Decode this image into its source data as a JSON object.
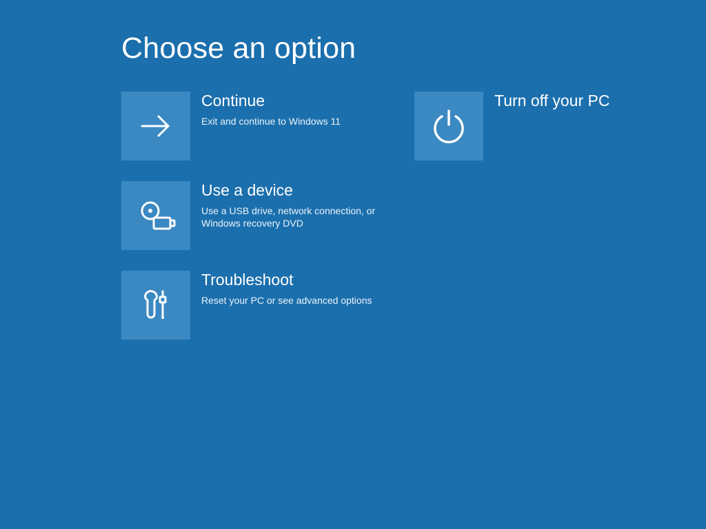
{
  "header": {
    "title": "Choose an option"
  },
  "colors": {
    "background": "#1b6fad",
    "tile": "#3b89c2",
    "text": "#ffffff"
  },
  "options": {
    "continue": {
      "title": "Continue",
      "desc": "Exit and continue to Windows 11",
      "icon": "arrow-right-icon"
    },
    "use_device": {
      "title": "Use a device",
      "desc": "Use a USB drive, network connection, or Windows recovery DVD",
      "icon": "usb-device-icon"
    },
    "troubleshoot": {
      "title": "Troubleshoot",
      "desc": "Reset your PC or see advanced options",
      "icon": "tools-icon"
    },
    "turn_off": {
      "title": "Turn off your PC",
      "desc": "",
      "icon": "power-icon"
    }
  }
}
